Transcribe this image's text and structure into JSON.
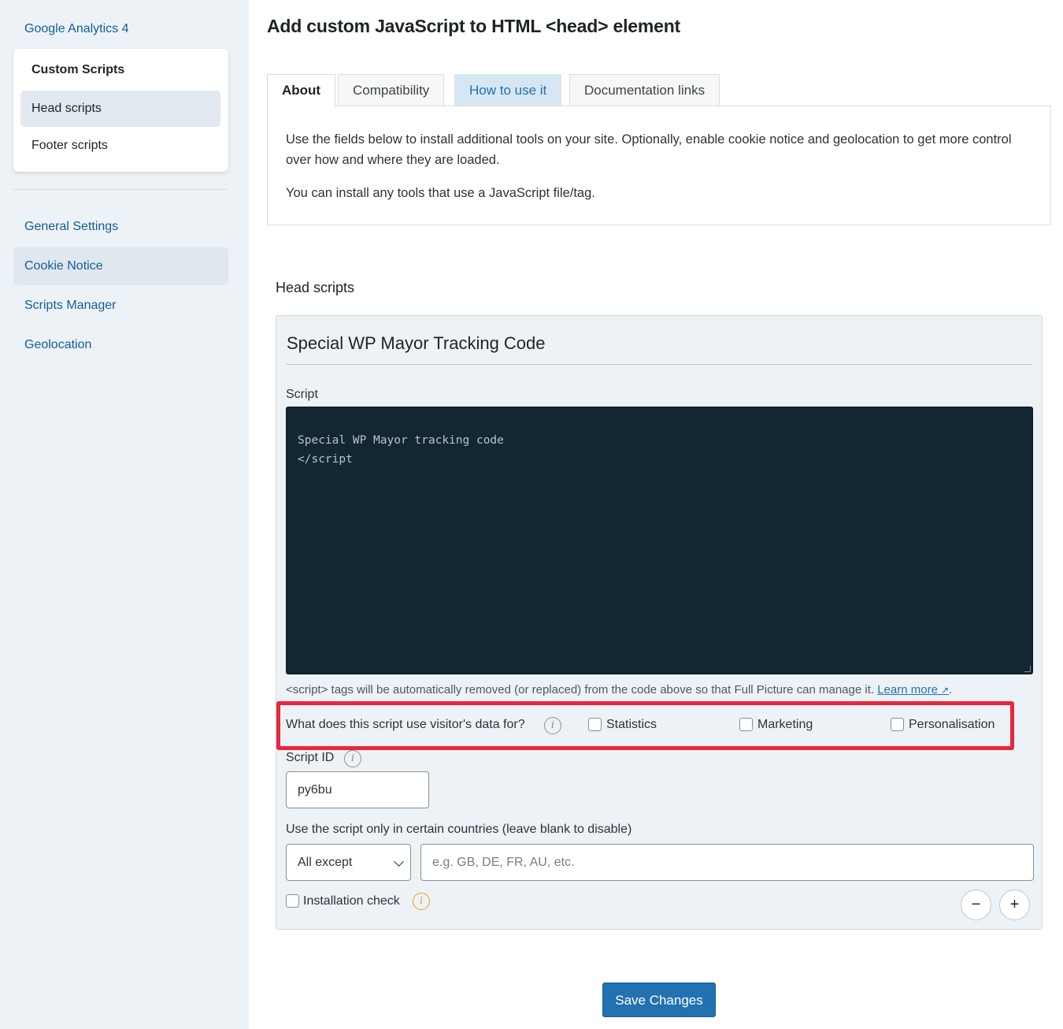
{
  "sidebar": {
    "top_link": "Google Analytics 4",
    "submenu": {
      "heading": "Custom Scripts",
      "items": [
        {
          "label": "Head scripts",
          "active": true
        },
        {
          "label": "Footer scripts",
          "active": false
        }
      ]
    },
    "nav": [
      {
        "label": "General Settings",
        "active": false
      },
      {
        "label": "Cookie Notice",
        "active": true
      },
      {
        "label": "Scripts Manager",
        "active": false
      },
      {
        "label": "Geolocation",
        "active": false
      }
    ]
  },
  "main": {
    "title": "Add custom JavaScript to HTML <head> element",
    "tabs": [
      {
        "label": "About",
        "state": "active"
      },
      {
        "label": "Compatibility",
        "state": "normal"
      },
      {
        "label": "How to use it",
        "state": "highlight"
      },
      {
        "label": "Documentation links",
        "state": "normal"
      }
    ],
    "about_text": [
      "Use the fields below to install additional tools on your site. Optionally, enable cookie notice and geolocation to get more control over how and where they are loaded.",
      "You can install any tools that use a JavaScript file/tag."
    ],
    "section_title": "Head scripts",
    "script": {
      "name": "Special WP Mayor Tracking Code",
      "script_label": "Script",
      "code_lines": [
        "Special WP Mayor tracking code",
        "</script"
      ],
      "note": "<script> tags will be automatically removed (or replaced) from the code above so that Full Picture can manage it. ",
      "learn_more": "Learn more",
      "note_end": ".",
      "usage_question": "What does this script use visitor's data for?",
      "usage_options": [
        {
          "label": "Statistics",
          "checked": false
        },
        {
          "label": "Marketing",
          "checked": false
        },
        {
          "label": "Personalisation",
          "checked": false
        }
      ],
      "script_id_label": "Script ID",
      "script_id_value": "py6bu",
      "countries_label": "Use the script only in certain countries (leave blank to disable)",
      "countries_mode": "All except",
      "countries_placeholder": "e.g. GB, DE, FR, AU, etc.",
      "installation_check_label": "Installation check",
      "minus": "−",
      "plus": "+"
    },
    "save_label": "Save Changes"
  },
  "colors": {
    "accent": "#2271b1",
    "highlight_border": "#e7283b",
    "code_bg": "#132733",
    "sidebar_bg": "#edf2f7"
  }
}
